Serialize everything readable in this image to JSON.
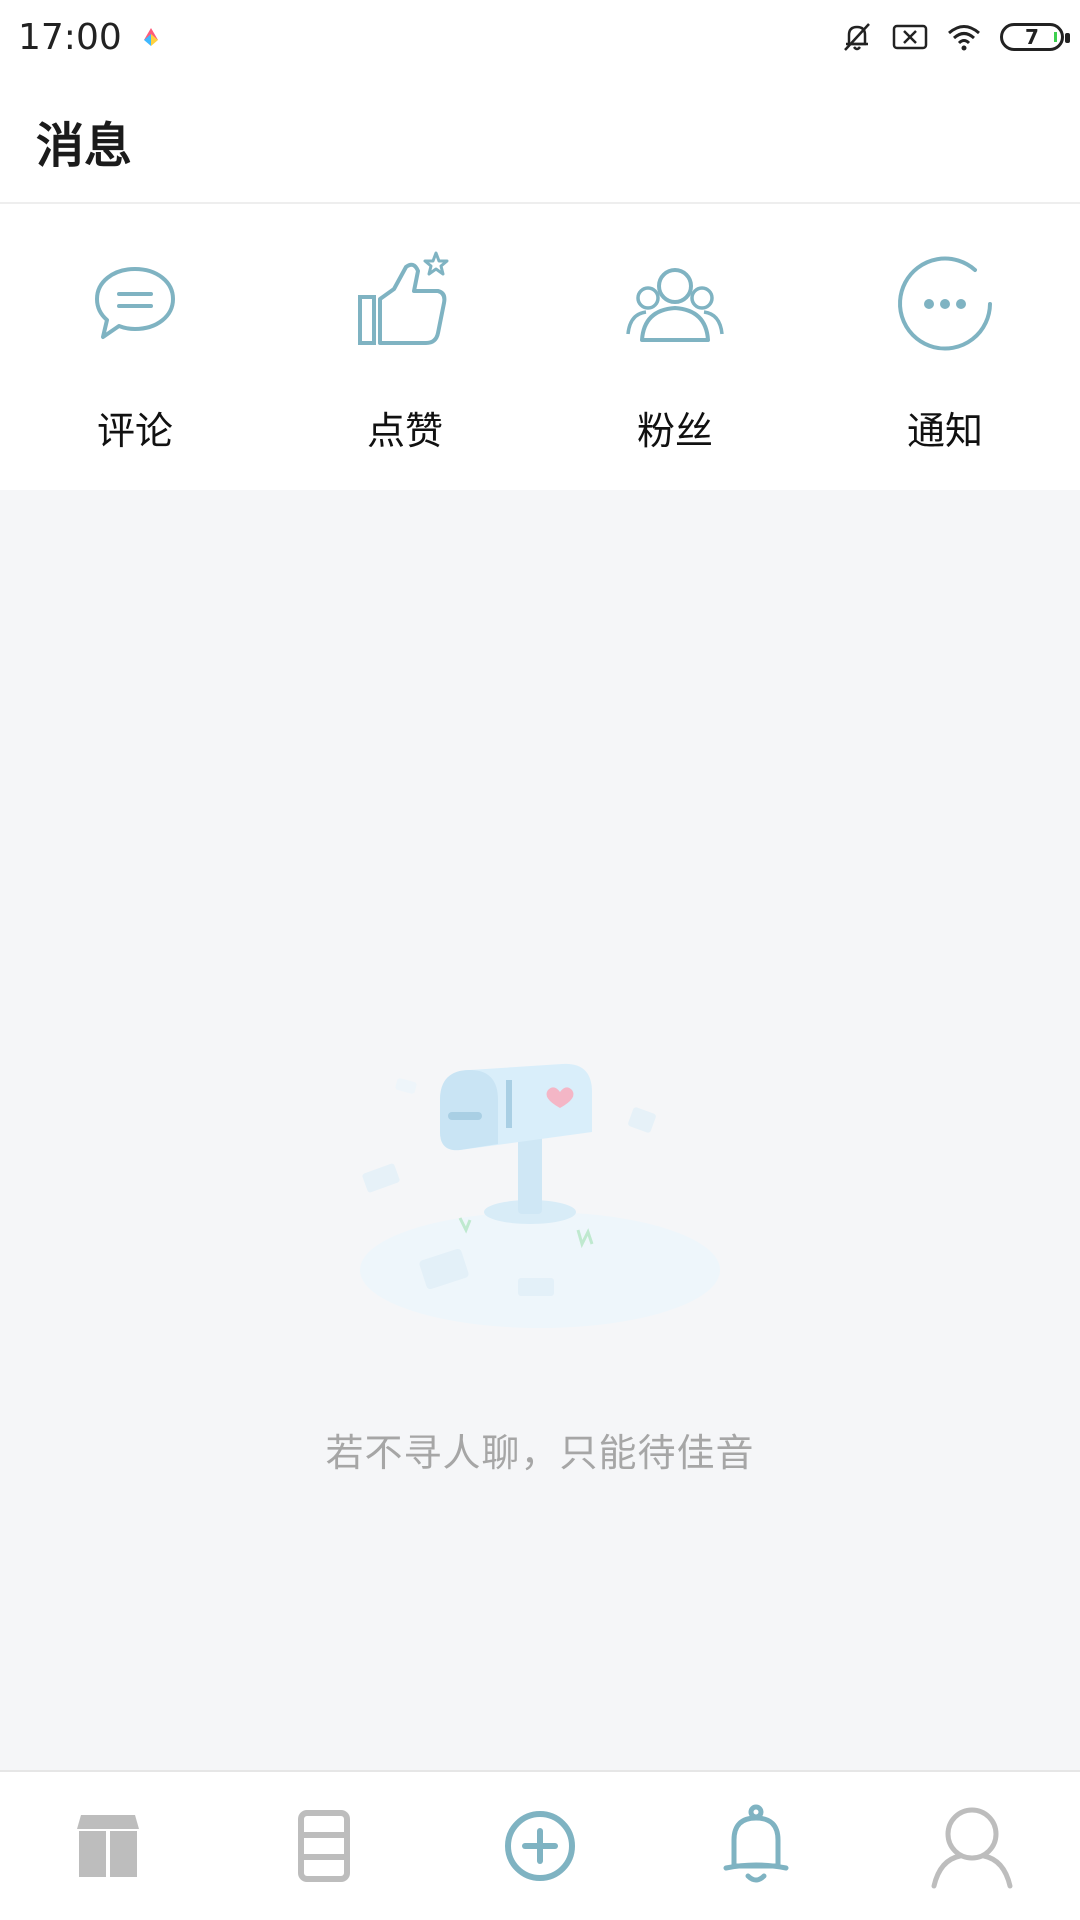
{
  "status_bar": {
    "time": "17:00",
    "battery_level": "7",
    "icons": [
      "app-logo-icon",
      "mute-bell-icon",
      "sim-x-icon",
      "wifi-icon",
      "battery-icon"
    ]
  },
  "header": {
    "title": "消息"
  },
  "categories": [
    {
      "label": "评论",
      "icon": "comment-icon"
    },
    {
      "label": "点赞",
      "icon": "thumbs-up-icon"
    },
    {
      "label": "粉丝",
      "icon": "fans-icon"
    },
    {
      "label": "通知",
      "icon": "notification-more-icon"
    }
  ],
  "empty_state": {
    "text": "若不寻人聊，只能待佳音",
    "illustration": "mailbox-illustration"
  },
  "tabbar": {
    "tabs": [
      {
        "icon": "home-box-icon",
        "active": false
      },
      {
        "icon": "list-icon",
        "active": false
      },
      {
        "icon": "add-circle-icon",
        "active": false
      },
      {
        "icon": "bell-icon",
        "active": true
      },
      {
        "icon": "profile-icon",
        "active": false
      }
    ]
  },
  "colors": {
    "accent": "#7fb3c2",
    "inactive": "#bdbdbd",
    "content_bg": "#f5f6f8"
  }
}
